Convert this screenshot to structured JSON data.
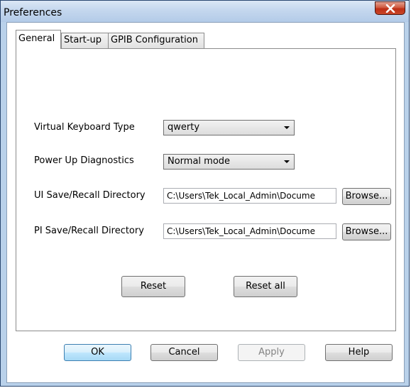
{
  "window": {
    "title": "Preferences",
    "close_glyph": "X"
  },
  "tabs": [
    {
      "label": "General",
      "active": true
    },
    {
      "label": "Start-up",
      "active": false
    },
    {
      "label": "GPIB Configuration",
      "active": false
    }
  ],
  "general": {
    "virtual_keyboard": {
      "label": "Virtual Keyboard Type",
      "value": "qwerty"
    },
    "power_up": {
      "label": "Power Up Diagnostics",
      "value": "Normal mode"
    },
    "ui_dir": {
      "label": "UI Save/Recall Directory",
      "value": "C:\\Users\\Tek_Local_Admin\\Docume",
      "browse_label": "Browse..."
    },
    "pi_dir": {
      "label": "PI Save/Recall Directory",
      "value": "C:\\Users\\Tek_Local_Admin\\Docume",
      "browse_label": "Browse..."
    },
    "reset_label": "Reset",
    "reset_all_label": "Reset all"
  },
  "footer": {
    "ok_label": "OK",
    "cancel_label": "Cancel",
    "apply_label": "Apply",
    "help_label": "Help"
  },
  "colors": {
    "frame": "#b9d1ea",
    "close_button": "#c9472a",
    "default_button": "#bee6fd"
  },
  "icons": {
    "close": "close-icon",
    "dropdown": "chevron-down-icon"
  }
}
